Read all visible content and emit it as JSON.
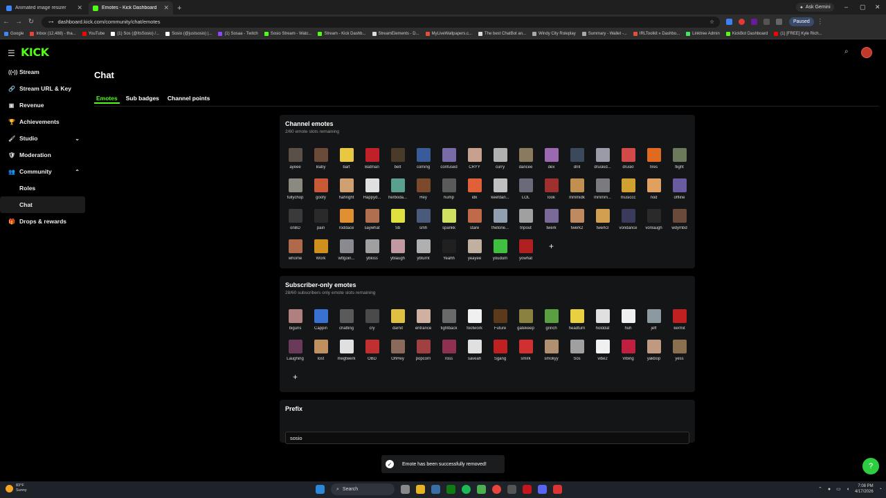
{
  "browser": {
    "tabs": [
      {
        "title": "Animated image resizer",
        "active": false,
        "color": "#3a86ff"
      },
      {
        "title": "Emotes - Kick Dashboard",
        "active": true,
        "color": "#53fc18"
      }
    ],
    "ask_gemini": "Ask Gemini",
    "url": "dashboard.kick.com/community/chat/emotes",
    "profile": "Paused",
    "bookmarks": [
      {
        "label": "Google",
        "color": "#4285f4"
      },
      {
        "label": "Inbox (12,488) - tha...",
        "color": "#ea4335"
      },
      {
        "label": "YouTube",
        "color": "#ff0000"
      },
      {
        "label": "(1) Sos (@ItsSosio) /...",
        "color": "#ffffff"
      },
      {
        "label": "Sosio (@justsosio) |...",
        "color": "#ffffff"
      },
      {
        "label": "(1) Sosaa - Twitch",
        "color": "#9146ff"
      },
      {
        "label": "Sosio Stream - Watc...",
        "color": "#53fc18"
      },
      {
        "label": "Stream - Kick Dashb...",
        "color": "#53fc18"
      },
      {
        "label": "StreamElements - D...",
        "color": "#dddddd"
      },
      {
        "label": "MyLiveWallpapers.c...",
        "color": "#e74c3c"
      },
      {
        "label": "The best ChatBot an...",
        "color": "#dddddd"
      },
      {
        "label": "Windy City Roleplay",
        "color": "#aaaaaa"
      },
      {
        "label": "Summary - Wallet -...",
        "color": "#aaaaaa"
      },
      {
        "label": "IRLToolkit » Dashbo...",
        "color": "#e74c3c"
      },
      {
        "label": "Linktree Admin",
        "color": "#43e660"
      },
      {
        "label": "KickBot Dashboard",
        "color": "#53fc18"
      },
      {
        "label": "(1) [FREE] Kyle Rich...",
        "color": "#ff0000"
      }
    ]
  },
  "header": {
    "logo": "KICK",
    "hamburger_icon": "☰",
    "search_icon": "⌕"
  },
  "sidebar": {
    "items": [
      {
        "label": "Stream",
        "icon": "((•))"
      },
      {
        "label": "Stream URL & Key",
        "icon": "🔗"
      },
      {
        "label": "Revenue",
        "icon": "▣"
      },
      {
        "label": "Achievements",
        "icon": "🏆"
      },
      {
        "label": "Studio",
        "icon": "🖌",
        "chevron": "⌄"
      },
      {
        "label": "Moderation",
        "icon": "🛡"
      },
      {
        "label": "Community",
        "icon": "👥",
        "chevron": "⌃"
      }
    ],
    "subitems": [
      {
        "label": "Roles"
      },
      {
        "label": "Chat"
      }
    ],
    "last": {
      "label": "Drops & rewards",
      "icon": "🎁"
    }
  },
  "page": {
    "title": "Chat",
    "tabs": [
      "Emotes",
      "Sub badges",
      "Channel points"
    ]
  },
  "channel_emotes": {
    "title": "Channel emotes",
    "subtitle": "2/60 emote slots remaining",
    "emotes": [
      {
        "name": "ayeee",
        "color": "#5a5048"
      },
      {
        "name": "Baby",
        "color": "#6b4a3a"
      },
      {
        "name": "bart",
        "color": "#e8c840"
      },
      {
        "name": "Batman",
        "color": "#c0202a"
      },
      {
        "name": "belt",
        "color": "#4a3a2a"
      },
      {
        "name": "coming",
        "color": "#3a5a9a"
      },
      {
        "name": "confused",
        "color": "#7a6aa8"
      },
      {
        "name": "CRYY",
        "color": "#c8a090"
      },
      {
        "name": "curry",
        "color": "#b0b0b0"
      },
      {
        "name": "dancee",
        "color": "#8a7a60"
      },
      {
        "name": "dex",
        "color": "#9a6ab0"
      },
      {
        "name": "drill",
        "color": "#3a4a5a"
      },
      {
        "name": "druskid...",
        "color": "#9a9aa8"
      },
      {
        "name": "druskI",
        "color": "#d04a4a"
      },
      {
        "name": "fires",
        "color": "#e06a20"
      },
      {
        "name": "flight",
        "color": "#6a7a5a"
      },
      {
        "name": "fullychop",
        "color": "#8a8a80"
      },
      {
        "name": "goofy",
        "color": "#c85a3a"
      },
      {
        "name": "hahright",
        "color": "#d0a070"
      },
      {
        "name": "Happyd...",
        "color": "#e0e0e0"
      },
      {
        "name": "herboda...",
        "color": "#5aa090"
      },
      {
        "name": "Hey",
        "color": "#7a4a2a"
      },
      {
        "name": "hump",
        "color": "#5a5a5a"
      },
      {
        "name": "idk",
        "color": "#e0603a"
      },
      {
        "name": "keefdan...",
        "color": "#c0c0c0"
      },
      {
        "name": "LOL",
        "color": "#6a6a7a"
      },
      {
        "name": "look",
        "color": "#a03030"
      },
      {
        "name": "mmmidk",
        "color": "#c09050"
      },
      {
        "name": "mmmm...",
        "color": "#7a7a80"
      },
      {
        "name": "musiccc",
        "color": "#d0a030"
      },
      {
        "name": "nod",
        "color": "#e0a060"
      },
      {
        "name": "offline",
        "color": "#6a5aa0"
      },
      {
        "name": "onBD",
        "color": "#3a3a3a"
      },
      {
        "name": "pain",
        "color": "#2a2a2a"
      },
      {
        "name": "roddace",
        "color": "#e09030"
      },
      {
        "name": "saywhat",
        "color": "#b07050"
      },
      {
        "name": "Sb",
        "color": "#e0e040"
      },
      {
        "name": "smh",
        "color": "#4a5a7a"
      },
      {
        "name": "spankk",
        "color": "#d0e060"
      },
      {
        "name": "stare",
        "color": "#c06a4a"
      },
      {
        "name": "thetone...",
        "color": "#90a0b0"
      },
      {
        "name": "tripout",
        "color": "#a0a0a0"
      },
      {
        "name": "twerk",
        "color": "#7a6a9a"
      },
      {
        "name": "twerk2",
        "color": "#c08a60"
      },
      {
        "name": "twerk3",
        "color": "#d0a050"
      },
      {
        "name": "vondance",
        "color": "#3a3a5a"
      },
      {
        "name": "vonlaugh",
        "color": "#2a2a2a"
      },
      {
        "name": "wdymbd",
        "color": "#6a4a3a"
      },
      {
        "name": "whome",
        "color": "#b06a4a"
      },
      {
        "name": "Work",
        "color": "#d09020"
      },
      {
        "name": "wtfgoin...",
        "color": "#8a8a90"
      },
      {
        "name": "ybkiss",
        "color": "#a0a0a0"
      },
      {
        "name": "yblaugh",
        "color": "#c09aa0"
      },
      {
        "name": "ybturnt",
        "color": "#b0b0b0"
      },
      {
        "name": "Yeahh",
        "color": "#202020"
      },
      {
        "name": "yeayee",
        "color": "#c0b0a0"
      },
      {
        "name": "youdum",
        "color": "#40c040"
      },
      {
        "name": "yowhat",
        "color": "#b02020"
      }
    ]
  },
  "subscriber_emotes": {
    "title": "Subscriber-only emotes",
    "subtitle": "28/60 subscribers only emote slots remaining",
    "emotes": [
      {
        "name": "biguns",
        "color": "#b08080"
      },
      {
        "name": "Cappin",
        "color": "#3a70d0"
      },
      {
        "name": "chatting",
        "color": "#5a5a5a"
      },
      {
        "name": "cry",
        "color": "#4a4a4a"
      },
      {
        "name": "darnit",
        "color": "#e0c040"
      },
      {
        "name": "entrance",
        "color": "#d0b0a0"
      },
      {
        "name": "fightback",
        "color": "#6a6a6a"
      },
      {
        "name": "footwork",
        "color": "#f0f0f0"
      },
      {
        "name": "Future",
        "color": "#5a3a1a"
      },
      {
        "name": "gatekeep",
        "color": "#8a8040"
      },
      {
        "name": "grinch",
        "color": "#5aa040"
      },
      {
        "name": "headturn",
        "color": "#e8d040"
      },
      {
        "name": "holddat",
        "color": "#e0e0e0"
      },
      {
        "name": "huh",
        "color": "#f0f0f0"
      },
      {
        "name": "jeff",
        "color": "#8a9aa0"
      },
      {
        "name": "kermit",
        "color": "#c02020"
      },
      {
        "name": "Laughing",
        "color": "#6a3a5a"
      },
      {
        "name": "lost",
        "color": "#c09060"
      },
      {
        "name": "megtwerk",
        "color": "#e0e0e0"
      },
      {
        "name": "OBD",
        "color": "#c03030"
      },
      {
        "name": "OhHey",
        "color": "#8a6a5a"
      },
      {
        "name": "popcorn",
        "color": "#a04040"
      },
      {
        "name": "ross",
        "color": "#903050"
      },
      {
        "name": "saveah",
        "color": "#e0e0e0"
      },
      {
        "name": "Sgang",
        "color": "#c02020"
      },
      {
        "name": "smirk",
        "color": "#d03030"
      },
      {
        "name": "smokyy",
        "color": "#b09070"
      },
      {
        "name": "Sos",
        "color": "#a0a0a0"
      },
      {
        "name": "vibe2",
        "color": "#f0f0f0"
      },
      {
        "name": "Vibing",
        "color": "#c02040"
      },
      {
        "name": "yakbop",
        "color": "#c09a80"
      },
      {
        "name": "yess",
        "color": "#8a7050"
      }
    ]
  },
  "prefix": {
    "title": "Prefix",
    "value": "sosio"
  },
  "toast": {
    "icon": "✓",
    "message": "Emote has been successfully removed!"
  },
  "taskbar": {
    "weather_temp": "83°F",
    "weather_desc": "Sunny",
    "search_label": "Search",
    "time": "7:08 PM",
    "date": "4/17/2026"
  },
  "colors": {
    "brand": "#53fc18",
    "card": "#141516",
    "background": "#000000"
  }
}
